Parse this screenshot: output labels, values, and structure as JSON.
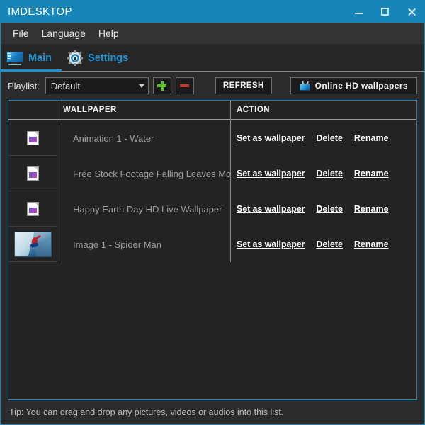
{
  "window": {
    "title": "IMDESKTOP",
    "controls": {
      "minimize": "minimize-icon",
      "maximize": "maximize-icon",
      "close": "close-icon"
    },
    "accent_color": "#1785b8",
    "background_color": "#2b2b2b"
  },
  "menu": {
    "items": [
      {
        "label": "File"
      },
      {
        "label": "Language"
      },
      {
        "label": "Help"
      }
    ]
  },
  "tabs": [
    {
      "label": "Main",
      "icon": "monitor-icon",
      "active": true
    },
    {
      "label": "Settings",
      "icon": "gear-icon",
      "active": false
    }
  ],
  "toolbar": {
    "playlist_label": "Playlist:",
    "playlist_value": "Default",
    "playlist_options": [
      "Default"
    ],
    "add_icon": "plus-icon",
    "add_color": "#5cc12a",
    "remove_icon": "minus-icon",
    "remove_color": "#c0392b",
    "refresh_label": "REFRESH",
    "online_label": "Online HD wallpapers",
    "online_icon": "tv-icon"
  },
  "list": {
    "columns": [
      "",
      "WALLPAPER",
      "ACTION"
    ],
    "actions": {
      "set": "Set as wallpaper",
      "delete": "Delete",
      "rename": "Rename"
    },
    "rows": [
      {
        "name": "Animation 1 - Water",
        "thumb": "file-icon"
      },
      {
        "name": "Free Stock Footage Falling Leaves Motion Backg",
        "thumb": "file-icon"
      },
      {
        "name": "Happy Earth Day HD Live Wallpaper",
        "thumb": "file-icon"
      },
      {
        "name": "Image 1 - Spider Man",
        "thumb": "image-thumbnail"
      }
    ]
  },
  "tip": {
    "text": "Tip: You can drag and drop any pictures, videos or audios into this list."
  }
}
